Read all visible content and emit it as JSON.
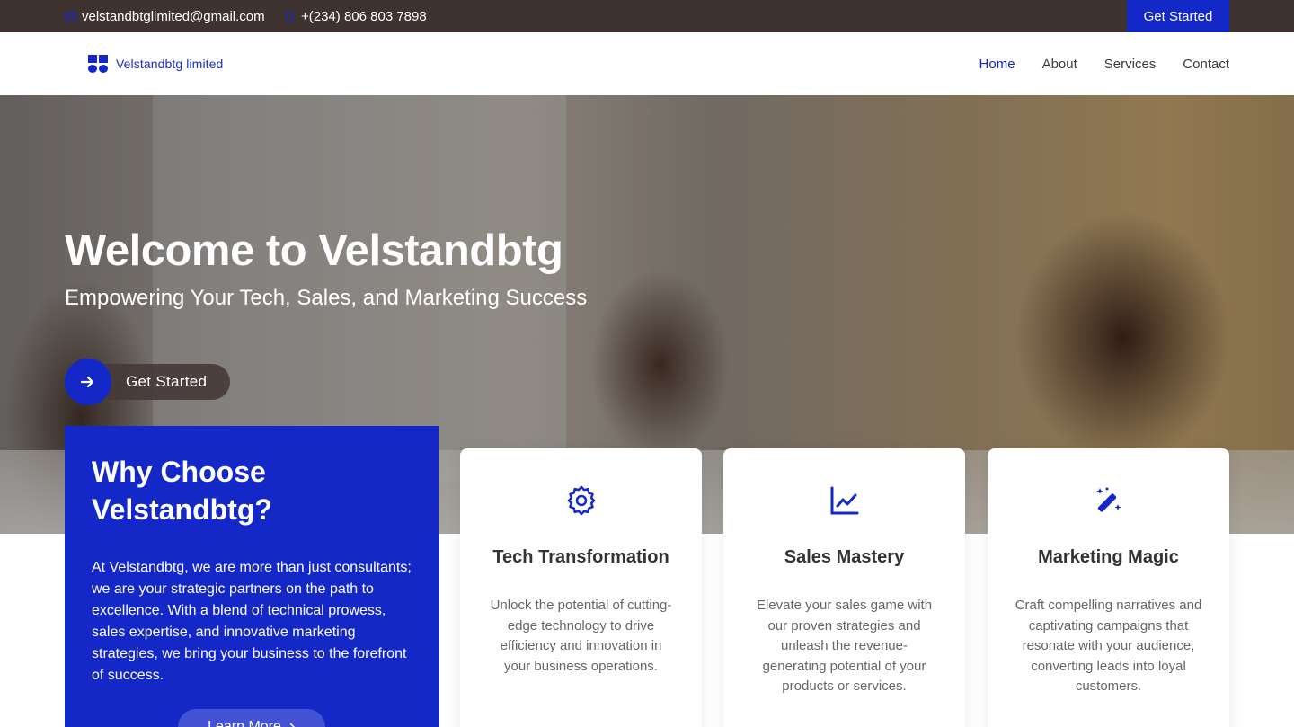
{
  "topbar": {
    "email": "velstandbtglimited@gmail.com",
    "email_icon": "envelope-icon",
    "phone": "+(234) 806 803 7898",
    "phone_icon": "phone-icon",
    "cta_label": "Get Started"
  },
  "header": {
    "logo_text": "Velstandbtg limited",
    "nav": [
      {
        "label": "Home",
        "active": true
      },
      {
        "label": "About",
        "active": false
      },
      {
        "label": "Services",
        "active": false
      },
      {
        "label": "Contact",
        "active": false
      }
    ]
  },
  "hero": {
    "title": "Welcome to Velstandbtg",
    "subtitle": "Empowering Your Tech, Sales, and Marketing Success",
    "button_label": "Get Started",
    "button_icon": "arrow-right-icon"
  },
  "why": {
    "title": "Why Choose Velstandbtg?",
    "body": "At Velstandbtg, we are more than just consultants; we are your strategic partners on the path to excellence. With a blend of technical prowess, sales expertise, and innovative marketing strategies, we bring your business to the forefront of success.",
    "button_label": "Learn More"
  },
  "cards": [
    {
      "icon": "gear-icon",
      "title": "Tech Transformation",
      "text": "Unlock the potential of cutting-edge technology to drive efficiency and innovation in your business operations."
    },
    {
      "icon": "line-chart-icon",
      "title": "Sales Mastery",
      "text": "Elevate your sales game with our proven strategies and unleash the revenue-generating potential of your products or services."
    },
    {
      "icon": "magic-wand-icon",
      "title": "Marketing Magic",
      "text": "Craft compelling narratives and captivating campaigns that resonate with your audience, converting leads into loyal customers."
    }
  ],
  "colors": {
    "accent": "#1428c8",
    "topbar": "#3f3332"
  }
}
